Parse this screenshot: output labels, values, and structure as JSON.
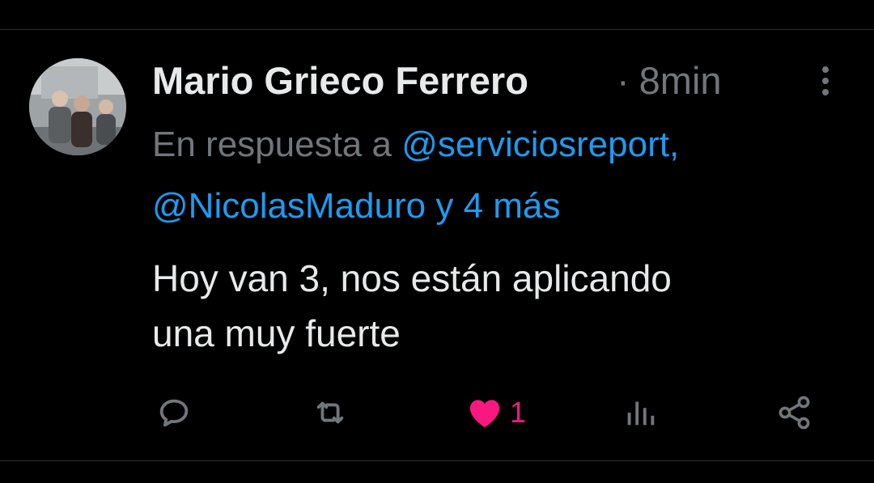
{
  "tweet": {
    "author_name": "Mario Grieco Ferrero",
    "separator": "·",
    "time": "8min",
    "reply_prefix": "En respuesta a",
    "mention_1": "@serviciosreport,",
    "mention_2": "@NicolasMaduro",
    "and_more": "y 4 más",
    "text_line_1": "Hoy van 3, nos están aplicando",
    "text_line_2": "una muy fuerte"
  },
  "actions": {
    "like_count": "1",
    "liked": true
  },
  "colors": {
    "background": "#000000",
    "text": "#e7e9ea",
    "muted": "#71767b",
    "link": "#1d9bf0",
    "like": "#f91880",
    "divider": "#2f3336"
  },
  "icons": {
    "reply": "reply-icon",
    "retweet": "retweet-icon",
    "like": "heart-icon",
    "views": "views-icon",
    "share": "share-icon",
    "more": "more-options-icon"
  }
}
